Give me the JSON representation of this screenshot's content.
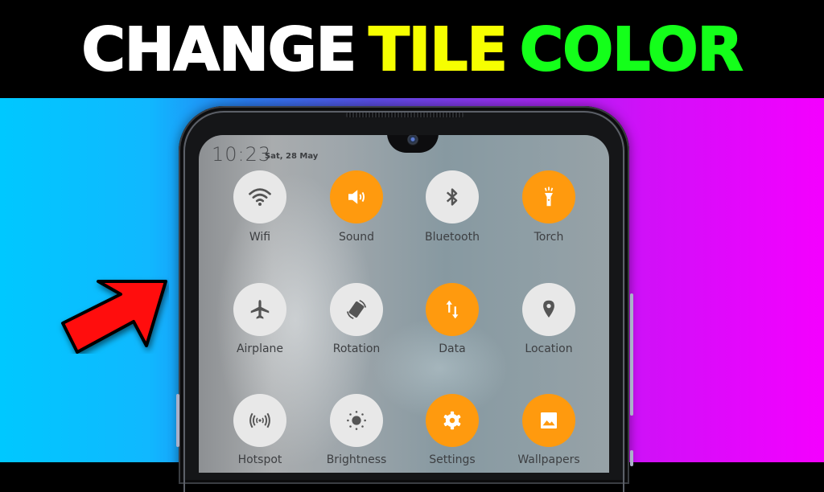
{
  "headline": {
    "words": [
      {
        "text": "CHANGE",
        "color": "#ffffff"
      },
      {
        "text": "TILE",
        "color": "#f6ff00"
      },
      {
        "text": "COLOR",
        "color": "#14ff1a"
      }
    ]
  },
  "background": {
    "gradient_colors": [
      "#00c8ff",
      "#2a7cf0",
      "#9a2ef0",
      "#f400ff"
    ]
  },
  "arrow": {
    "color": "#ff0a0a",
    "direction": "up-right"
  },
  "status_bar": {
    "time": "10:23",
    "date": "Sat, 28 May"
  },
  "tile_colors": {
    "active": "#ff9a0e",
    "inactive": "#e8e8e8",
    "active_icon": "#ffffff",
    "inactive_icon": "#555555"
  },
  "quick_tiles": [
    {
      "label": "Wifi",
      "icon": "wifi-icon",
      "state": "off"
    },
    {
      "label": "Sound",
      "icon": "sound-icon",
      "state": "on"
    },
    {
      "label": "Bluetooth",
      "icon": "bluetooth-icon",
      "state": "off"
    },
    {
      "label": "Torch",
      "icon": "torch-icon",
      "state": "on"
    },
    {
      "label": "Airplane",
      "icon": "airplane-icon",
      "state": "off"
    },
    {
      "label": "Rotation",
      "icon": "rotation-icon",
      "state": "off"
    },
    {
      "label": "Data",
      "icon": "data-icon",
      "state": "on"
    },
    {
      "label": "Location",
      "icon": "location-icon",
      "state": "off"
    },
    {
      "label": "Hotspot",
      "icon": "hotspot-icon",
      "state": "off"
    },
    {
      "label": "Brightness",
      "icon": "brightness-icon",
      "state": "off"
    },
    {
      "label": "Settings",
      "icon": "settings-icon",
      "state": "on"
    },
    {
      "label": "Wallpapers",
      "icon": "wallpapers-icon",
      "state": "on"
    }
  ]
}
